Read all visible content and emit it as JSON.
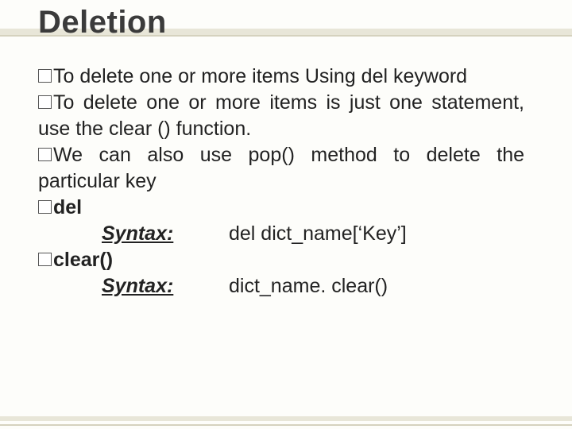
{
  "title": "Deletion",
  "bullets": {
    "b1": "To delete one or more items Using del keyword",
    "b2": "To delete one or more items is just one statement, use the clear () function.",
    "b3": "We can also use pop() method to delete the particular key",
    "b4": "del",
    "b5": "clear()"
  },
  "syntax": {
    "label": "Syntax:",
    "del_code": "del dict_name[‘Key’]",
    "clear_code": "dict_name. clear()"
  }
}
